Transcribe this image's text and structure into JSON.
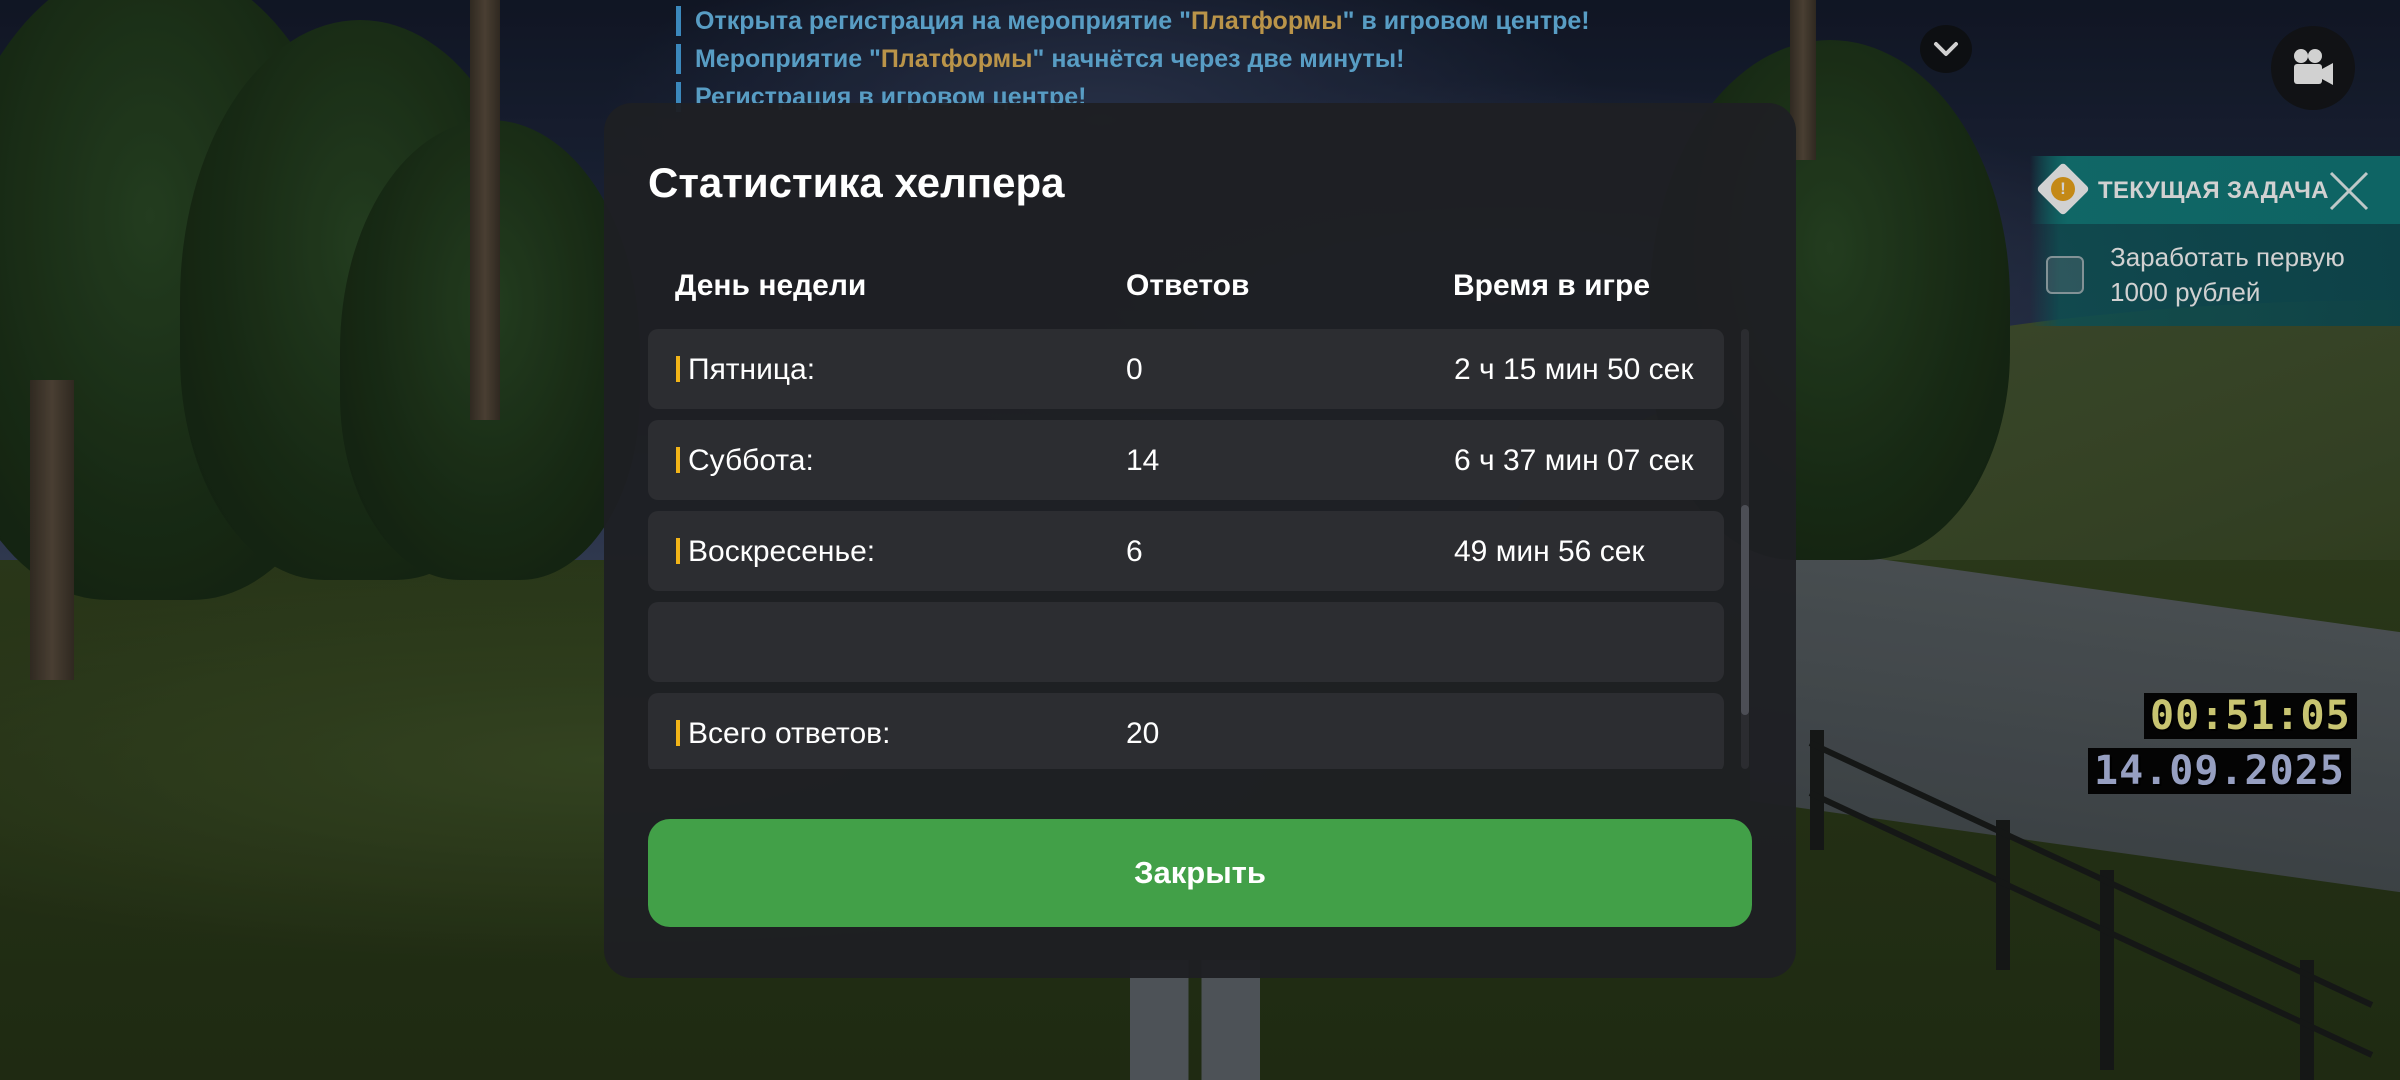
{
  "chat": {
    "lines": [
      {
        "pre": "Открыта регистрация на мероприятие \"",
        "hl": "Платформы",
        "post": "\" в игровом центре!"
      },
      {
        "pre": "Мероприятие \"",
        "hl": "Платформы",
        "post": "\" начнётся через две минуты!"
      },
      {
        "pre": "Регистрация в игровом центре!",
        "hl": "",
        "post": ""
      }
    ]
  },
  "task": {
    "title": "ТЕКУЩАЯ ЗАДАЧА",
    "item": "Заработать первую 1000 рублей",
    "icon": "exclamation-icon"
  },
  "clock": {
    "time": "00:51:05",
    "date": "14.09.2025"
  },
  "modal": {
    "title": "Статистика хелпера",
    "columns": {
      "day": "День недели",
      "answers": "Ответов",
      "time": "Время в игре"
    },
    "rows": [
      {
        "day": "Пятница:",
        "answers": "0",
        "time": "2 ч 15 мин 50 сек"
      },
      {
        "day": "Суббота:",
        "answers": "14",
        "time": "6 ч 37 мин 07 сек"
      },
      {
        "day": "Воскресенье:",
        "answers": "6",
        "time": "49 мин 56 сек"
      },
      {
        "day": "",
        "answers": "",
        "time": ""
      },
      {
        "day": "Всего ответов:",
        "answers": "20",
        "time": ""
      }
    ],
    "close_label": "Закрыть"
  },
  "colors": {
    "accent_green": "#42a048",
    "marker_yellow": "#f2b418",
    "chat_blue": "#6cc0f0",
    "chat_highlight": "#e3b55a",
    "clock_time": "#f4ef8a",
    "clock_date": "#b8c3ec"
  }
}
